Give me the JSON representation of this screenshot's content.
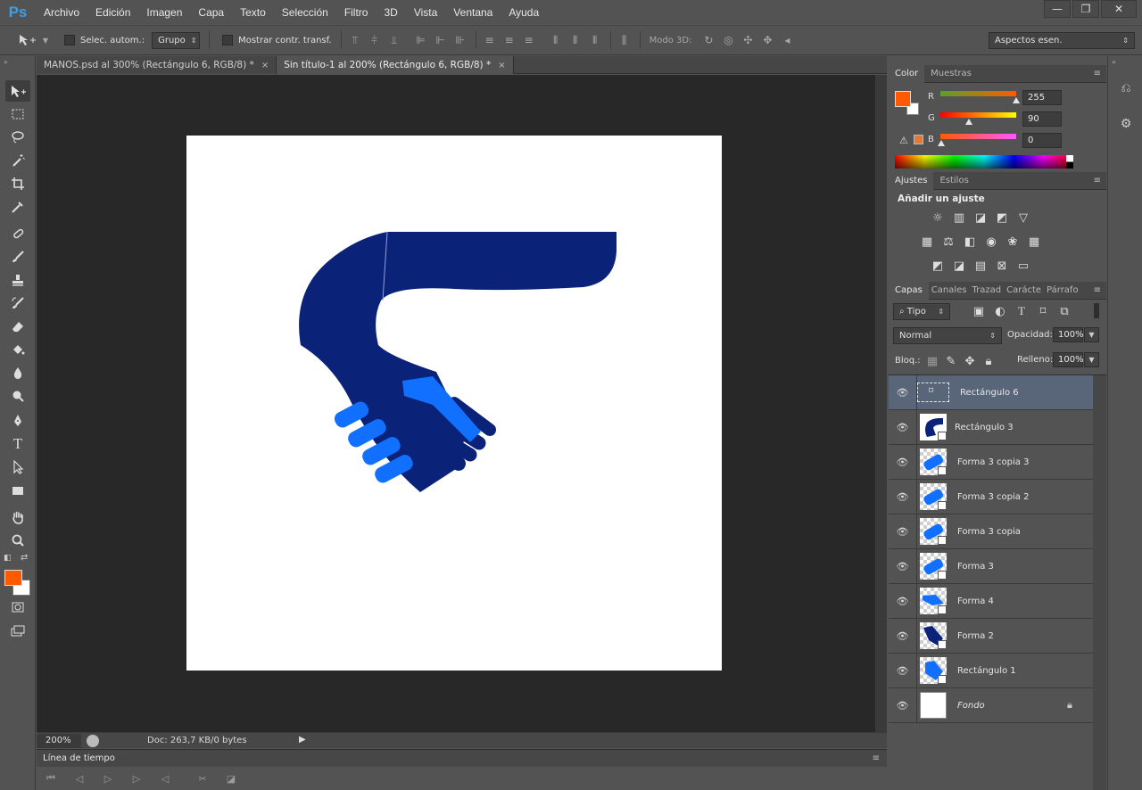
{
  "app": {
    "logo": "Ps"
  },
  "menu": [
    "Archivo",
    "Edición",
    "Imagen",
    "Capa",
    "Texto",
    "Selección",
    "Filtro",
    "3D",
    "Vista",
    "Ventana",
    "Ayuda"
  ],
  "window_controls": {
    "minimize": "—",
    "restore": "❐",
    "close": "✕"
  },
  "options": {
    "auto_select_label": "Selec. autom.:",
    "auto_select_value": "Grupo",
    "transform_label": "Mostrar contr. transf.",
    "mode3d_label": "Modo 3D:",
    "workspace_value": "Aspectos esen."
  },
  "tabs": [
    {
      "label": "MANOS.psd al 300% (Rectángulo 6, RGB/8) *",
      "close": "×"
    },
    {
      "label": "Sin título-1 al 200% (Rectángulo 6, RGB/8) *",
      "close": "×"
    }
  ],
  "status": {
    "zoom": "200%",
    "doc_info": "Doc: 263,7 KB/0 bytes"
  },
  "timeline": {
    "title": "Línea de tiempo"
  },
  "color_panel": {
    "tabs": [
      "Color",
      "Muestras"
    ],
    "r_label": "R",
    "r_value": "255",
    "g_label": "G",
    "g_value": "90",
    "b_label": "B",
    "b_value": "0",
    "fg_color": "#FF5A00",
    "bg_color": "#FFFFFF"
  },
  "adjust_panel": {
    "tabs": [
      "Ajustes",
      "Estilos"
    ],
    "title": "Añadir un ajuste"
  },
  "layers_panel": {
    "tabs": [
      "Capas",
      "Canales",
      "Trazad",
      "Carácte",
      "Párrafo"
    ],
    "filter": "Tipo",
    "blend_mode": "Normal",
    "opacity_label": "Opacidad:",
    "opacity_value": "100%",
    "lock_label": "Bloq.:",
    "fill_label": "Relleno:",
    "fill_value": "100%",
    "layers": [
      {
        "name": "Rectángulo 6"
      },
      {
        "name": "Rectángulo 3"
      },
      {
        "name": "Forma 3 copia 3"
      },
      {
        "name": "Forma 3 copia 2"
      },
      {
        "name": "Forma 3 copia"
      },
      {
        "name": "Forma 3"
      },
      {
        "name": "Forma 4"
      },
      {
        "name": "Forma 2"
      },
      {
        "name": "Rectángulo 1"
      },
      {
        "name": "Fondo"
      }
    ]
  },
  "art_colors": {
    "dark_blue": "#0B2279",
    "mid_blue": "#0A2078",
    "light_blue": "#1170FF"
  },
  "icons": [
    "move-icon",
    "marquee-icon",
    "lasso-icon",
    "magic-wand-icon",
    "crop-icon",
    "eyedropper-icon",
    "healing-brush-icon",
    "brush-icon",
    "clone-stamp-icon",
    "history-brush-icon",
    "eraser-icon",
    "paint-bucket-icon",
    "blur-icon",
    "dodge-icon",
    "pen-icon",
    "type-icon",
    "path-select-icon",
    "rectangle-icon",
    "hand-icon",
    "zoom-icon",
    "eye-icon",
    "lock-icon"
  ]
}
